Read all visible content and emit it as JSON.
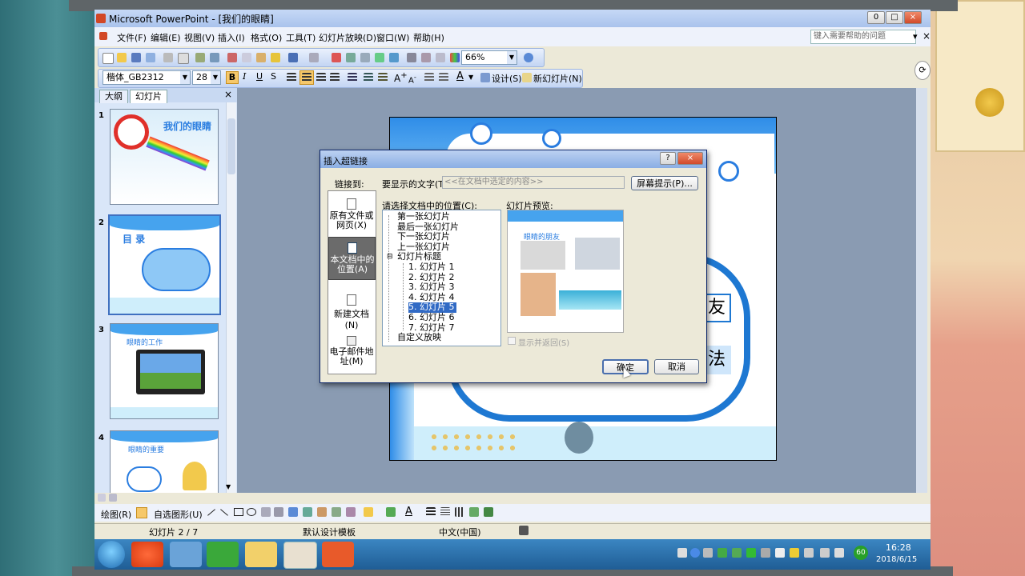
{
  "window": {
    "title": "Microsoft PowerPoint - [我们的眼睛]",
    "minimize": "0",
    "restore": "□",
    "close": "×"
  },
  "menu": {
    "items": [
      "文件(F)",
      "编辑(E)",
      "视图(V)",
      "插入(I)",
      "格式(O)",
      "工具(T)",
      "幻灯片放映(D)",
      "窗口(W)",
      "帮助(H)"
    ],
    "help_placeholder": "键入需要帮助的问题",
    "close": "×"
  },
  "toolbar": {
    "zoom": "66%",
    "font_name": "楷体_GB2312",
    "font_size": "28",
    "bold": "B",
    "italic": "I",
    "underline": "U",
    "shadow": "S",
    "design_label": "设计(S)",
    "new_slide_label": "新幻灯片(N)"
  },
  "pane": {
    "tab_outline": "大纲",
    "tab_slides": "幻灯片",
    "close": "×",
    "slides": [
      {
        "num": "1",
        "title": "我们的眼睛"
      },
      {
        "num": "2",
        "title": "目 录"
      },
      {
        "num": "3",
        "title": "眼睛的工作"
      },
      {
        "num": "4",
        "title": "眼睛的重要"
      }
    ]
  },
  "slide": {
    "friend_char": "友",
    "method_char": "法"
  },
  "dialog": {
    "title": "插入超链接",
    "help": "?",
    "close": "×",
    "link_to_label": "链接到:",
    "display_text_label": "要显示的文字(T):",
    "display_text_value": "<<在文档中选定的内容>>",
    "screentip_button": "屏幕提示(P)...",
    "places": [
      {
        "label": "原有文件或网页(X)",
        "icon": "web-page-icon"
      },
      {
        "label": "本文档中的位置(A)",
        "icon": "document-place-icon"
      },
      {
        "label": "新建文档(N)",
        "icon": "new-document-icon"
      },
      {
        "label": "电子邮件地址(M)",
        "icon": "email-icon"
      }
    ],
    "select_place_label": "请选择文档中的位置(C):",
    "tree": [
      {
        "label": "第一张幻灯片",
        "indent": 1
      },
      {
        "label": "最后一张幻灯片",
        "indent": 1
      },
      {
        "label": "下一张幻灯片",
        "indent": 1
      },
      {
        "label": "上一张幻灯片",
        "indent": 1
      },
      {
        "label": "幻灯片标题",
        "indent": 1,
        "expander": "⊟"
      },
      {
        "label": "1. 幻灯片 1",
        "indent": 2
      },
      {
        "label": "2. 幻灯片 2",
        "indent": 2
      },
      {
        "label": "3. 幻灯片 3",
        "indent": 2
      },
      {
        "label": "4. 幻灯片 4",
        "indent": 2
      },
      {
        "label": "5. 幻灯片 5",
        "indent": 2,
        "selected": true
      },
      {
        "label": "6. 幻灯片 6",
        "indent": 2
      },
      {
        "label": "7. 幻灯片 7",
        "indent": 2
      },
      {
        "label": "自定义放映",
        "indent": 1
      }
    ],
    "preview_label": "幻灯片预览:",
    "preview_title": "眼睛的朋友",
    "show_return_label": "显示并返回(S)",
    "ok": "确定",
    "cancel": "取消"
  },
  "drawbar": {
    "draw_label": "绘图(R)",
    "autoshapes_label": "自选图形(U)"
  },
  "status": {
    "slide_pos": "幻灯片 2 / 7",
    "design": "默认设计模板",
    "language": "中文(中国)"
  },
  "taskbar": {
    "time": "16:28",
    "date": "2018/6/15",
    "badge": "60"
  },
  "colors": {
    "accent_blue": "#1e78d2",
    "selection": "#316ac5",
    "taskbar": "#2a6aa8"
  }
}
